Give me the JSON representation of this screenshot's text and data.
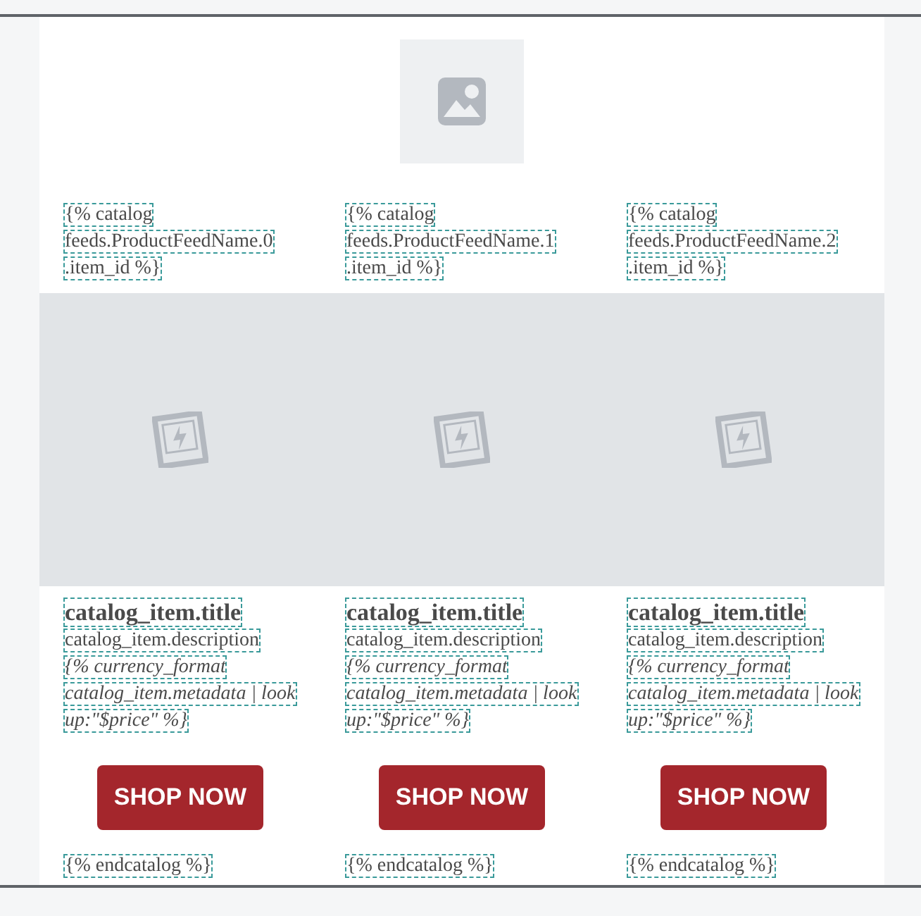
{
  "columns": [
    {
      "item_id_lines": [
        "{% catalog",
        "feeds.ProductFeedName.0",
        ".item_id %}"
      ],
      "title": "catalog_item.title",
      "description": "catalog_item.description",
      "price_lines": [
        "{% currency_format",
        "catalog_item.metadata | look",
        "up:\"$price\" %}"
      ],
      "button": "SHOP NOW",
      "end": "{% endcatalog %}"
    },
    {
      "item_id_lines": [
        "{% catalog",
        "feeds.ProductFeedName.1",
        ".item_id %}"
      ],
      "title": "catalog_item.title",
      "description": "catalog_item.description",
      "price_lines": [
        "{% currency_format",
        "catalog_item.metadata | look",
        "up:\"$price\" %}"
      ],
      "button": "SHOP NOW",
      "end": "{% endcatalog %}"
    },
    {
      "item_id_lines": [
        "{% catalog",
        "feeds.ProductFeedName.2",
        ".item_id %}"
      ],
      "title": "catalog_item.title",
      "description": "catalog_item.description",
      "price_lines": [
        "{% currency_format",
        "catalog_item.metadata | look",
        "up:\"$price\" %}"
      ],
      "button": "SHOP NOW",
      "end": "{% endcatalog %}"
    }
  ]
}
